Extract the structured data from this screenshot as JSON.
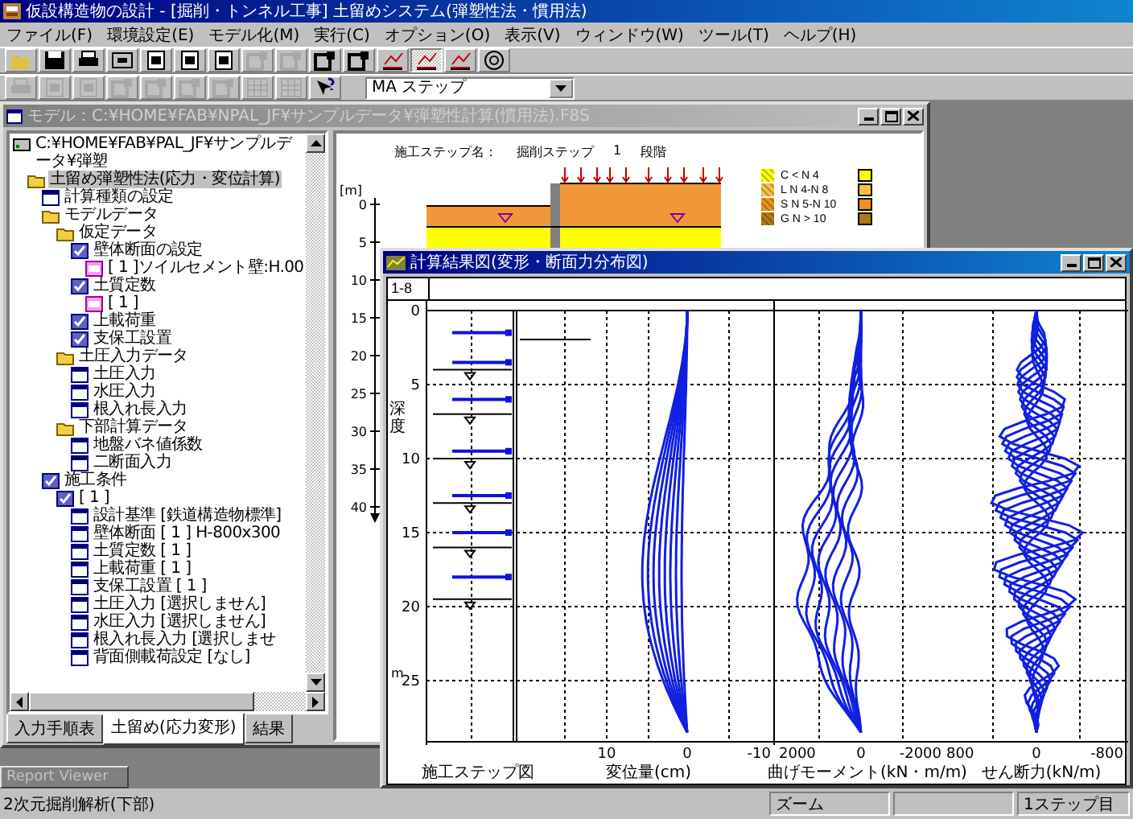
{
  "app": {
    "title": "仮設構造物の設計 - [掘削・トンネル工事] 土留めシステム(弾塑性法・慣用法)"
  },
  "menu": [
    "ファイル(F)",
    "環境設定(E)",
    "モデル化(M)",
    "実行(C)",
    "オプション(O)",
    "表示(V)",
    "ウィンドウ(W)",
    "ツール(T)",
    "ヘルプ(H)"
  ],
  "toolbar_1": [
    {
      "kind": "open",
      "disabled": false,
      "pressed": false
    },
    {
      "kind": "save",
      "disabled": false,
      "pressed": false
    },
    {
      "kind": "print",
      "disabled": false,
      "pressed": false
    },
    {
      "kind": "text",
      "disabled": false,
      "pressed": false
    },
    {
      "kind": "doc",
      "disabled": false,
      "pressed": false
    },
    {
      "kind": "doc",
      "disabled": false,
      "pressed": false
    },
    {
      "kind": "doc",
      "disabled": false,
      "pressed": false
    },
    {
      "kind": "table",
      "disabled": true,
      "pressed": false
    },
    {
      "kind": "table",
      "disabled": true,
      "pressed": false
    },
    {
      "kind": "table",
      "disabled": false,
      "pressed": false
    },
    {
      "kind": "table",
      "disabled": false,
      "pressed": false
    },
    {
      "kind": "chart",
      "disabled": false,
      "pressed": false
    },
    {
      "kind": "chart",
      "disabled": false,
      "pressed": true
    },
    {
      "kind": "chart",
      "disabled": false,
      "pressed": false
    },
    {
      "kind": "circle",
      "disabled": false,
      "pressed": false
    }
  ],
  "toolbar_2": [
    {
      "kind": "print",
      "disabled": true
    },
    {
      "kind": "doc",
      "disabled": true
    },
    {
      "kind": "doc",
      "disabled": true
    },
    {
      "kind": "table",
      "disabled": true
    },
    {
      "kind": "table",
      "disabled": true
    },
    {
      "kind": "table",
      "disabled": true
    },
    {
      "kind": "table",
      "disabled": true
    },
    {
      "kind": "grid",
      "disabled": true
    },
    {
      "kind": "grid",
      "disabled": true
    },
    {
      "kind": "help",
      "disabled": false
    }
  ],
  "step_combo": {
    "value": "MA ステップ"
  },
  "model_window": {
    "title": "モデル：C:¥HOME¥FAB¥NPAL_JF¥サンプルデータ¥弾塑性計算(慣用法).F8S",
    "active": false,
    "tree": [
      {
        "label": "C:¥HOME¥FAB¥PAL_JF¥サンプルデータ¥弾塑",
        "kind": "drive",
        "selected": false,
        "children": [
          {
            "label": "土留め弾塑性法(応力・変位計算)",
            "kind": "folder",
            "selected": true,
            "children": [
              {
                "label": "計算種類の設定",
                "kind": "form",
                "selected": false
              },
              {
                "label": "モデルデータ",
                "kind": "folder",
                "selected": false,
                "children": [
                  {
                    "label": "仮定データ",
                    "kind": "folder",
                    "selected": false,
                    "children": [
                      {
                        "label": "壁体断面の設定",
                        "kind": "check",
                        "selected": false,
                        "children": [
                          {
                            "label": "[ 1 ]ソイルセメント壁:H.00",
                            "kind": "data",
                            "selected": false
                          }
                        ]
                      },
                      {
                        "label": "土質定数",
                        "kind": "check",
                        "selected": false,
                        "children": [
                          {
                            "label": "[ 1 ]",
                            "kind": "data",
                            "selected": false
                          }
                        ]
                      },
                      {
                        "label": "上載荷重",
                        "kind": "check",
                        "selected": false
                      },
                      {
                        "label": "支保工設置",
                        "kind": "check",
                        "selected": false
                      }
                    ]
                  },
                  {
                    "label": "土圧入力データ",
                    "kind": "folder",
                    "selected": false,
                    "children": [
                      {
                        "label": "土圧入力",
                        "kind": "form",
                        "selected": false
                      },
                      {
                        "label": "水圧入力",
                        "kind": "form",
                        "selected": false
                      },
                      {
                        "label": "根入れ長入力",
                        "kind": "form",
                        "selected": false
                      }
                    ]
                  },
                  {
                    "label": "下部計算データ",
                    "kind": "folder",
                    "selected": false,
                    "children": [
                      {
                        "label": "地盤バネ値係数",
                        "kind": "form",
                        "selected": false
                      },
                      {
                        "label": "二断面入力",
                        "kind": "form",
                        "selected": false
                      }
                    ]
                  }
                ]
              },
              {
                "label": "施工条件",
                "kind": "check",
                "selected": false,
                "children": [
                  {
                    "label": "[ 1 ]",
                    "kind": "check",
                    "selected": false,
                    "children": [
                      {
                        "label": "設計基準 [鉄道構造物標準]",
                        "kind": "form",
                        "selected": false
                      },
                      {
                        "label": "壁体断面 [ 1 ] H-800x300",
                        "kind": "form",
                        "selected": false
                      },
                      {
                        "label": "土質定数 [ 1 ]",
                        "kind": "form",
                        "selected": false
                      },
                      {
                        "label": "上載荷重 [ 1 ]",
                        "kind": "form",
                        "selected": false
                      },
                      {
                        "label": "支保工設置 [ 1 ]",
                        "kind": "form",
                        "selected": false
                      },
                      {
                        "label": "土圧入力 [選択しません]",
                        "kind": "form",
                        "selected": false
                      },
                      {
                        "label": "水圧入力 [選択しません]",
                        "kind": "form",
                        "selected": false
                      },
                      {
                        "label": "根入れ長入力 [選択しませ",
                        "kind": "form",
                        "selected": false
                      },
                      {
                        "label": "背面側載荷設定 [なし]",
                        "kind": "form",
                        "selected": false
                      }
                    ]
                  }
                ]
              }
            ]
          }
        ]
      }
    ],
    "tabs": [
      {
        "label": "入力手順表",
        "selected": false
      },
      {
        "label": "土留め(応力変形)",
        "selected": true
      },
      {
        "label": "結果",
        "selected": false
      }
    ],
    "step_caption": [
      "施工ステップ名：",
      "掘削ステップ",
      "1",
      "段階"
    ],
    "legend": [
      {
        "label": "C < N 4",
        "color": "#ffff00"
      },
      {
        "label": "L N 4-N 8",
        "color": "#f8c040"
      },
      {
        "label": "S N 5-N 10",
        "color": "#f09020"
      },
      {
        "label": "G N > 10",
        "color": "#b07818"
      }
    ],
    "depth_axis": {
      "unit": "[m]",
      "ticks": [
        "0",
        "5",
        "10",
        "15",
        "20",
        "25",
        "30",
        "35",
        "40"
      ]
    }
  },
  "result_window": {
    "title": "計算結果図(変形・断面力分布図)",
    "active": true,
    "case_label": "1-8",
    "depth_label": "深度",
    "depth_unit": "m",
    "depth_ticks": [
      "0",
      "5",
      "10",
      "15",
      "20",
      "25"
    ],
    "panels": [
      {
        "label": "施工ステップ図"
      },
      {
        "label": "変位量(cm)",
        "ticks": [
          "10",
          "0",
          "-10"
        ]
      },
      {
        "label": "曲げモーメント(kN・m/m)",
        "ticks": [
          "2000",
          "0",
          "-2000"
        ]
      },
      {
        "label": "せん断力(kN/m)",
        "ticks": [
          "800",
          "0",
          "-800"
        ]
      }
    ]
  },
  "minimized_window": {
    "title": "Report Viewer"
  },
  "status_bar": {
    "message": "2次元掘削解析(下部)",
    "zoom": "ズーム",
    "step": "1ステップ目"
  }
}
